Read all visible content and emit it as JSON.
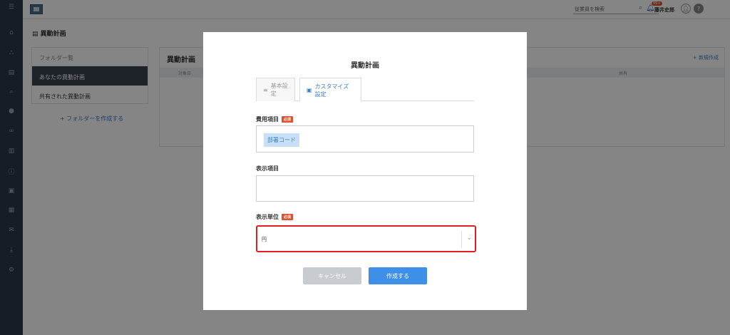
{
  "sidebar": {
    "icons": [
      "menu-icon",
      "home-icon",
      "org-chart-icon",
      "document-icon",
      "search-icon",
      "chat-icon",
      "link-icon",
      "chart-icon",
      "info-icon",
      "badge-icon",
      "book-icon",
      "mail-icon",
      "download-icon",
      "user-settings-icon"
    ]
  },
  "header": {
    "search_placeholder": "従業員を検索",
    "badge_count": "99+",
    "username": "藤井史郎"
  },
  "page": {
    "title": "異動計画",
    "folder_head": "フォルダー覧",
    "folders": [
      "あなたの異動計画",
      "共有された異動計画"
    ],
    "add_folder": "+ フォルダーを作成する",
    "main_title": "異動計画",
    "new_link": "+ 新規作成",
    "col1": "対象日",
    "col2": "共有"
  },
  "modal": {
    "title": "異動計画",
    "tab_basic": "基本設定",
    "tab_custom": "カスタマイズ設定",
    "field_cost": "費用項目",
    "required": "必須",
    "chip": "部署コード",
    "field_display": "表示項目",
    "field_unit": "表示単位",
    "unit_value": "円",
    "cancel": "キャンセル",
    "create": "作成する"
  },
  "colors": {
    "sidebar": "#2d3848",
    "accent": "#3d8fe8",
    "required": "#e0512f",
    "highlight": "#e02020"
  }
}
